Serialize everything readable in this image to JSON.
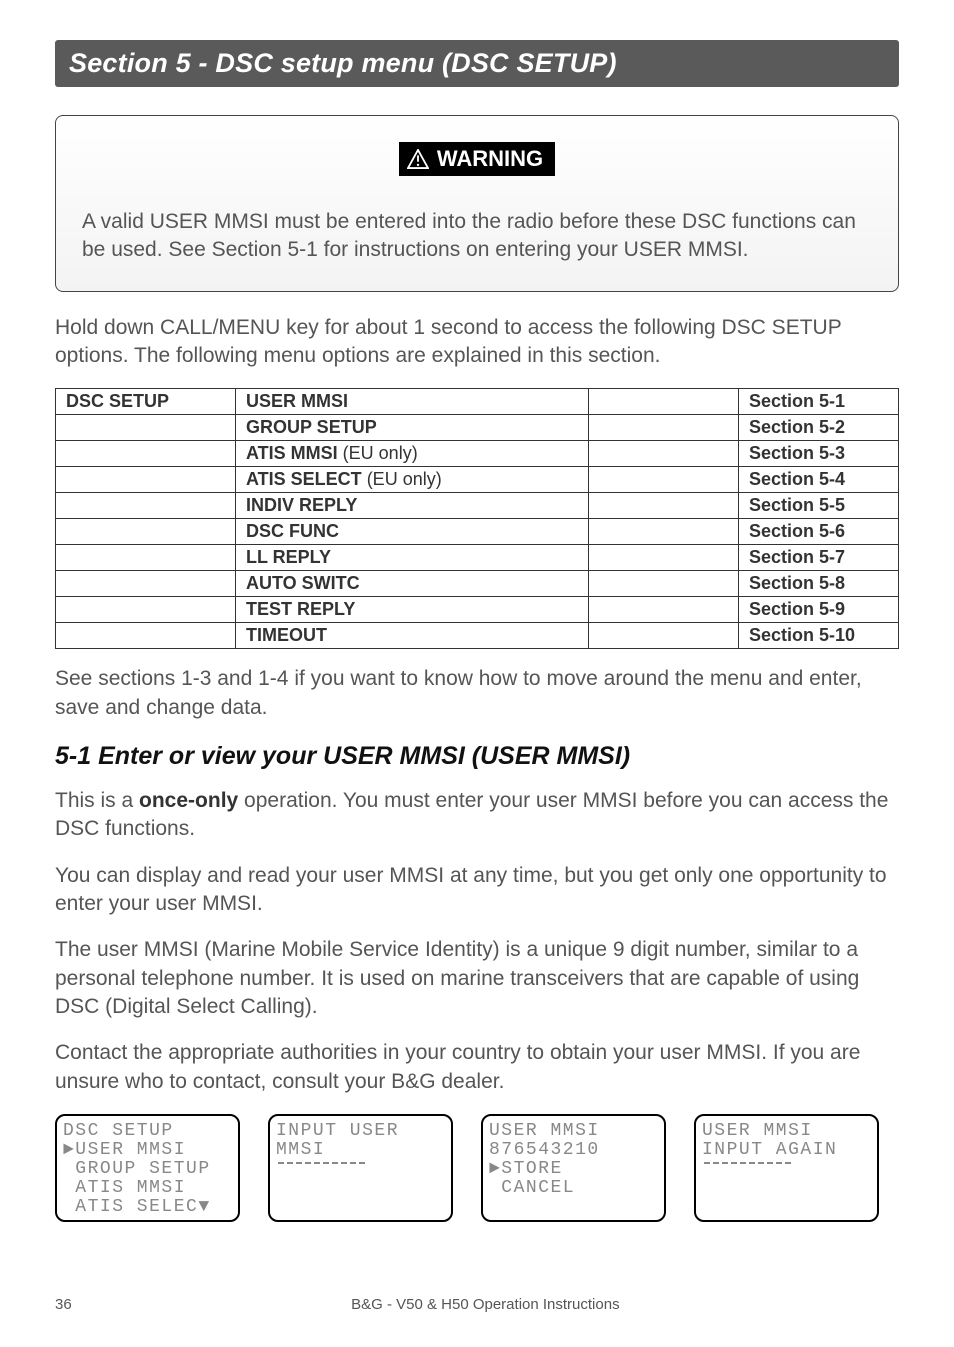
{
  "banner_title": "Section 5 - DSC setup menu (DSC SETUP)",
  "warning": {
    "label": "WARNING",
    "text": "A valid USER MMSI must be entered into the radio before these DSC functions can be used. See Section 5-1 for instructions on entering your USER MMSI."
  },
  "intro": "Hold down CALL/MENU key for about 1 second to access the following DSC SETUP options. The following menu options are explained in this section.",
  "table": {
    "col1_header": "DSC SETUP",
    "rows": [
      {
        "name": "USER MMSI",
        "note": "",
        "section": "Section 5-1"
      },
      {
        "name": "GROUP SETUP",
        "note": "",
        "section": "Section 5-2"
      },
      {
        "name": "ATIS MMSI",
        "note": "(EU only)",
        "section": "Section 5-3"
      },
      {
        "name": "ATIS SELECT",
        "note": "(EU only)",
        "section": "Section 5-4"
      },
      {
        "name": "INDIV REPLY",
        "note": "",
        "section": "Section 5-5"
      },
      {
        "name": "DSC FUNC",
        "note": "",
        "section": "Section 5-6"
      },
      {
        "name": "LL REPLY",
        "note": "",
        "section": "Section 5-7"
      },
      {
        "name": "AUTO SWITC",
        "note": "",
        "section": "Section 5-8"
      },
      {
        "name": "TEST REPLY",
        "note": "",
        "section": "Section 5-9"
      },
      {
        "name": "TIMEOUT",
        "note": "",
        "section": "Section 5-10"
      }
    ]
  },
  "post_table": "See sections 1-3 and 1-4 if you want to know how to move around the menu and enter, save and change data.",
  "subhead": "5-1 Enter or view your USER MMSI (USER MMSI)",
  "p1_a": "This is a ",
  "p1_b": "once-only",
  "p1_c": " operation. You must enter your user MMSI before you can access the DSC functions.",
  "p2": "You can display and read your user MMSI at any time, but you get only one opportunity to enter your user MMSI.",
  "p3": "The user MMSI (Marine Mobile Service Identity) is a unique 9 digit number, similar to a personal telephone number. It is used on marine transceivers that are capable of using DSC (Digital Select Calling).",
  "p4": "Contact the appropriate authorities in your country to obtain your user MMSI. If you are unsure who to contact, consult your B&G dealer.",
  "lcd": [
    {
      "lines": [
        "DSC SETUP",
        "►USER MMSI",
        " GROUP SETUP",
        " ATIS MMSI",
        " ATIS SELEC▼"
      ],
      "cursor": false
    },
    {
      "lines": [
        "INPUT USER",
        "MMSI"
      ],
      "cursor": true
    },
    {
      "lines": [
        "USER MMSI",
        "876543210",
        "►STORE",
        " CANCEL"
      ],
      "cursor": false
    },
    {
      "lines": [
        "USER MMSI",
        "INPUT AGAIN"
      ],
      "cursor": true
    }
  ],
  "footer": {
    "page": "36",
    "text": "B&G - V50 & H50 Operation Instructions"
  }
}
